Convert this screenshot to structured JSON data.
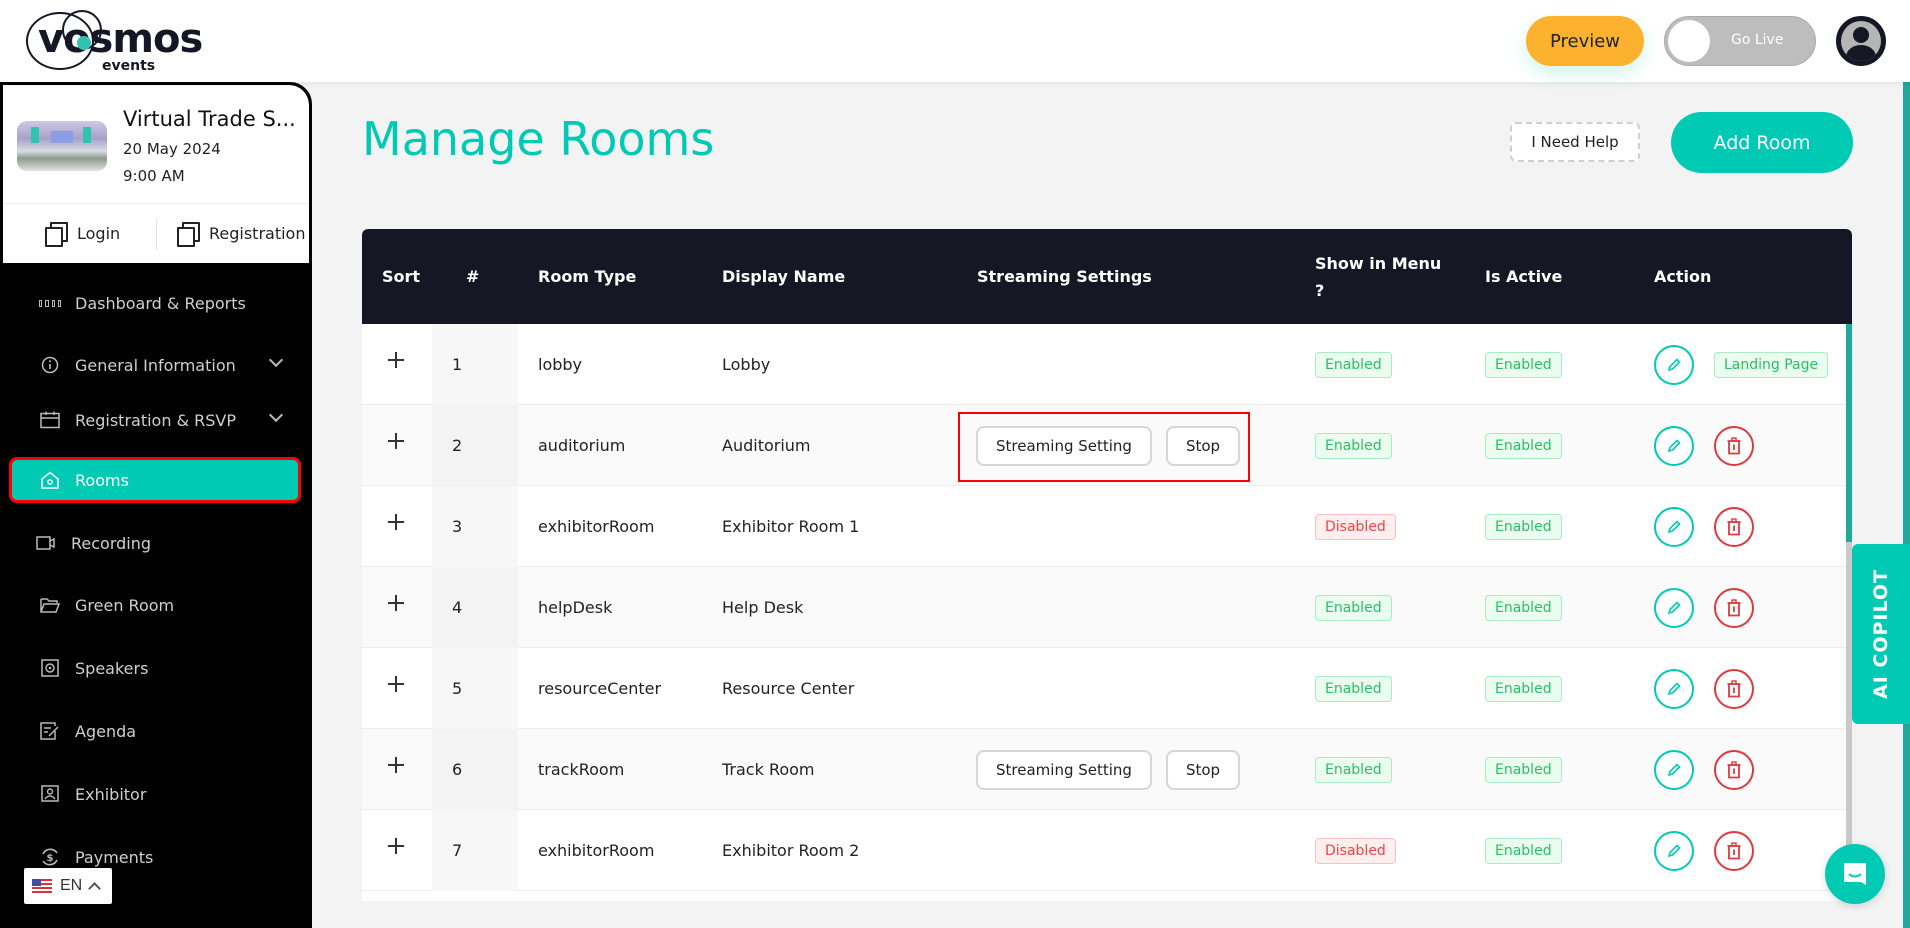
{
  "header": {
    "logo_text": "vosmos",
    "logo_sub": "events",
    "preview_label": "Preview",
    "go_live_label": "Go Live",
    "go_live_on": false
  },
  "sidebar": {
    "event": {
      "title": "Virtual Trade S...",
      "date": "20 May 2024",
      "time": "9:00 AM"
    },
    "quick_links": [
      {
        "label": "Login",
        "icon": "copy-icon"
      },
      {
        "label": "Registration",
        "icon": "copy-icon"
      }
    ],
    "items": [
      {
        "label": "Dashboard & Reports",
        "icon": "grid-icon",
        "expandable": false,
        "active": false
      },
      {
        "label": "General Information",
        "icon": "info-icon",
        "expandable": true,
        "active": false
      },
      {
        "label": "Registration & RSVP",
        "icon": "calendar-icon",
        "expandable": true,
        "active": false
      },
      {
        "label": "Rooms",
        "icon": "home-icon",
        "expandable": false,
        "active": true
      },
      {
        "label": "Recording",
        "icon": "video-icon",
        "expandable": false,
        "active": false
      },
      {
        "label": "Green Room",
        "icon": "folder-icon",
        "expandable": false,
        "active": false
      },
      {
        "label": "Speakers",
        "icon": "speaker-icon",
        "expandable": false,
        "active": false
      },
      {
        "label": "Agenda",
        "icon": "agenda-icon",
        "expandable": false,
        "active": false
      },
      {
        "label": "Exhibitor",
        "icon": "exhibitor-icon",
        "expandable": false,
        "active": false
      },
      {
        "label": "Payments",
        "icon": "payments-icon",
        "expandable": false,
        "active": false
      }
    ],
    "language": "EN"
  },
  "main": {
    "title": "Manage Rooms",
    "help_label": "I Need Help",
    "add_label": "Add Room",
    "table": {
      "columns": [
        "Sort",
        "#",
        "Room Type",
        "Display Name",
        "Streaming Settings",
        "Show in Menu ?",
        "Is Active",
        "Action"
      ],
      "rows": [
        {
          "num": "1",
          "room_type": "lobby",
          "display_name": "Lobby",
          "streaming": false,
          "show_in_menu": "Enabled",
          "is_active": "Enabled",
          "actions": [
            "edit",
            "Landing Page"
          ]
        },
        {
          "num": "2",
          "room_type": "auditorium",
          "display_name": "Auditorium",
          "streaming": true,
          "show_in_menu": "Enabled",
          "is_active": "Enabled",
          "actions": [
            "edit",
            "delete"
          ]
        },
        {
          "num": "3",
          "room_type": "exhibitorRoom",
          "display_name": "Exhibitor Room 1",
          "streaming": false,
          "show_in_menu": "Disabled",
          "is_active": "Enabled",
          "actions": [
            "edit",
            "delete"
          ]
        },
        {
          "num": "4",
          "room_type": "helpDesk",
          "display_name": "Help Desk",
          "streaming": false,
          "show_in_menu": "Enabled",
          "is_active": "Enabled",
          "actions": [
            "edit",
            "delete"
          ]
        },
        {
          "num": "5",
          "room_type": "resourceCenter",
          "display_name": "Resource Center",
          "streaming": false,
          "show_in_menu": "Enabled",
          "is_active": "Enabled",
          "actions": [
            "edit",
            "delete"
          ]
        },
        {
          "num": "6",
          "room_type": "trackRoom",
          "display_name": "Track Room",
          "streaming": true,
          "show_in_menu": "Enabled",
          "is_active": "Enabled",
          "actions": [
            "edit",
            "delete"
          ]
        },
        {
          "num": "7",
          "room_type": "exhibitorRoom",
          "display_name": "Exhibitor Room 2",
          "streaming": false,
          "show_in_menu": "Disabled",
          "is_active": "Enabled",
          "actions": [
            "edit",
            "delete"
          ]
        }
      ],
      "streaming_setting_label": "Streaming Setting",
      "stop_label": "Stop",
      "landing_page_label": "Landing Page"
    }
  },
  "copilot_label": "AI COPILOT",
  "colors": {
    "accent": "#00c9b4",
    "preview": "#fdb22f",
    "dark": "#151824",
    "enabled": "#2bbf62",
    "disabled": "#ef4444",
    "delete": "#e0383e",
    "highlight": "#ff0000"
  }
}
